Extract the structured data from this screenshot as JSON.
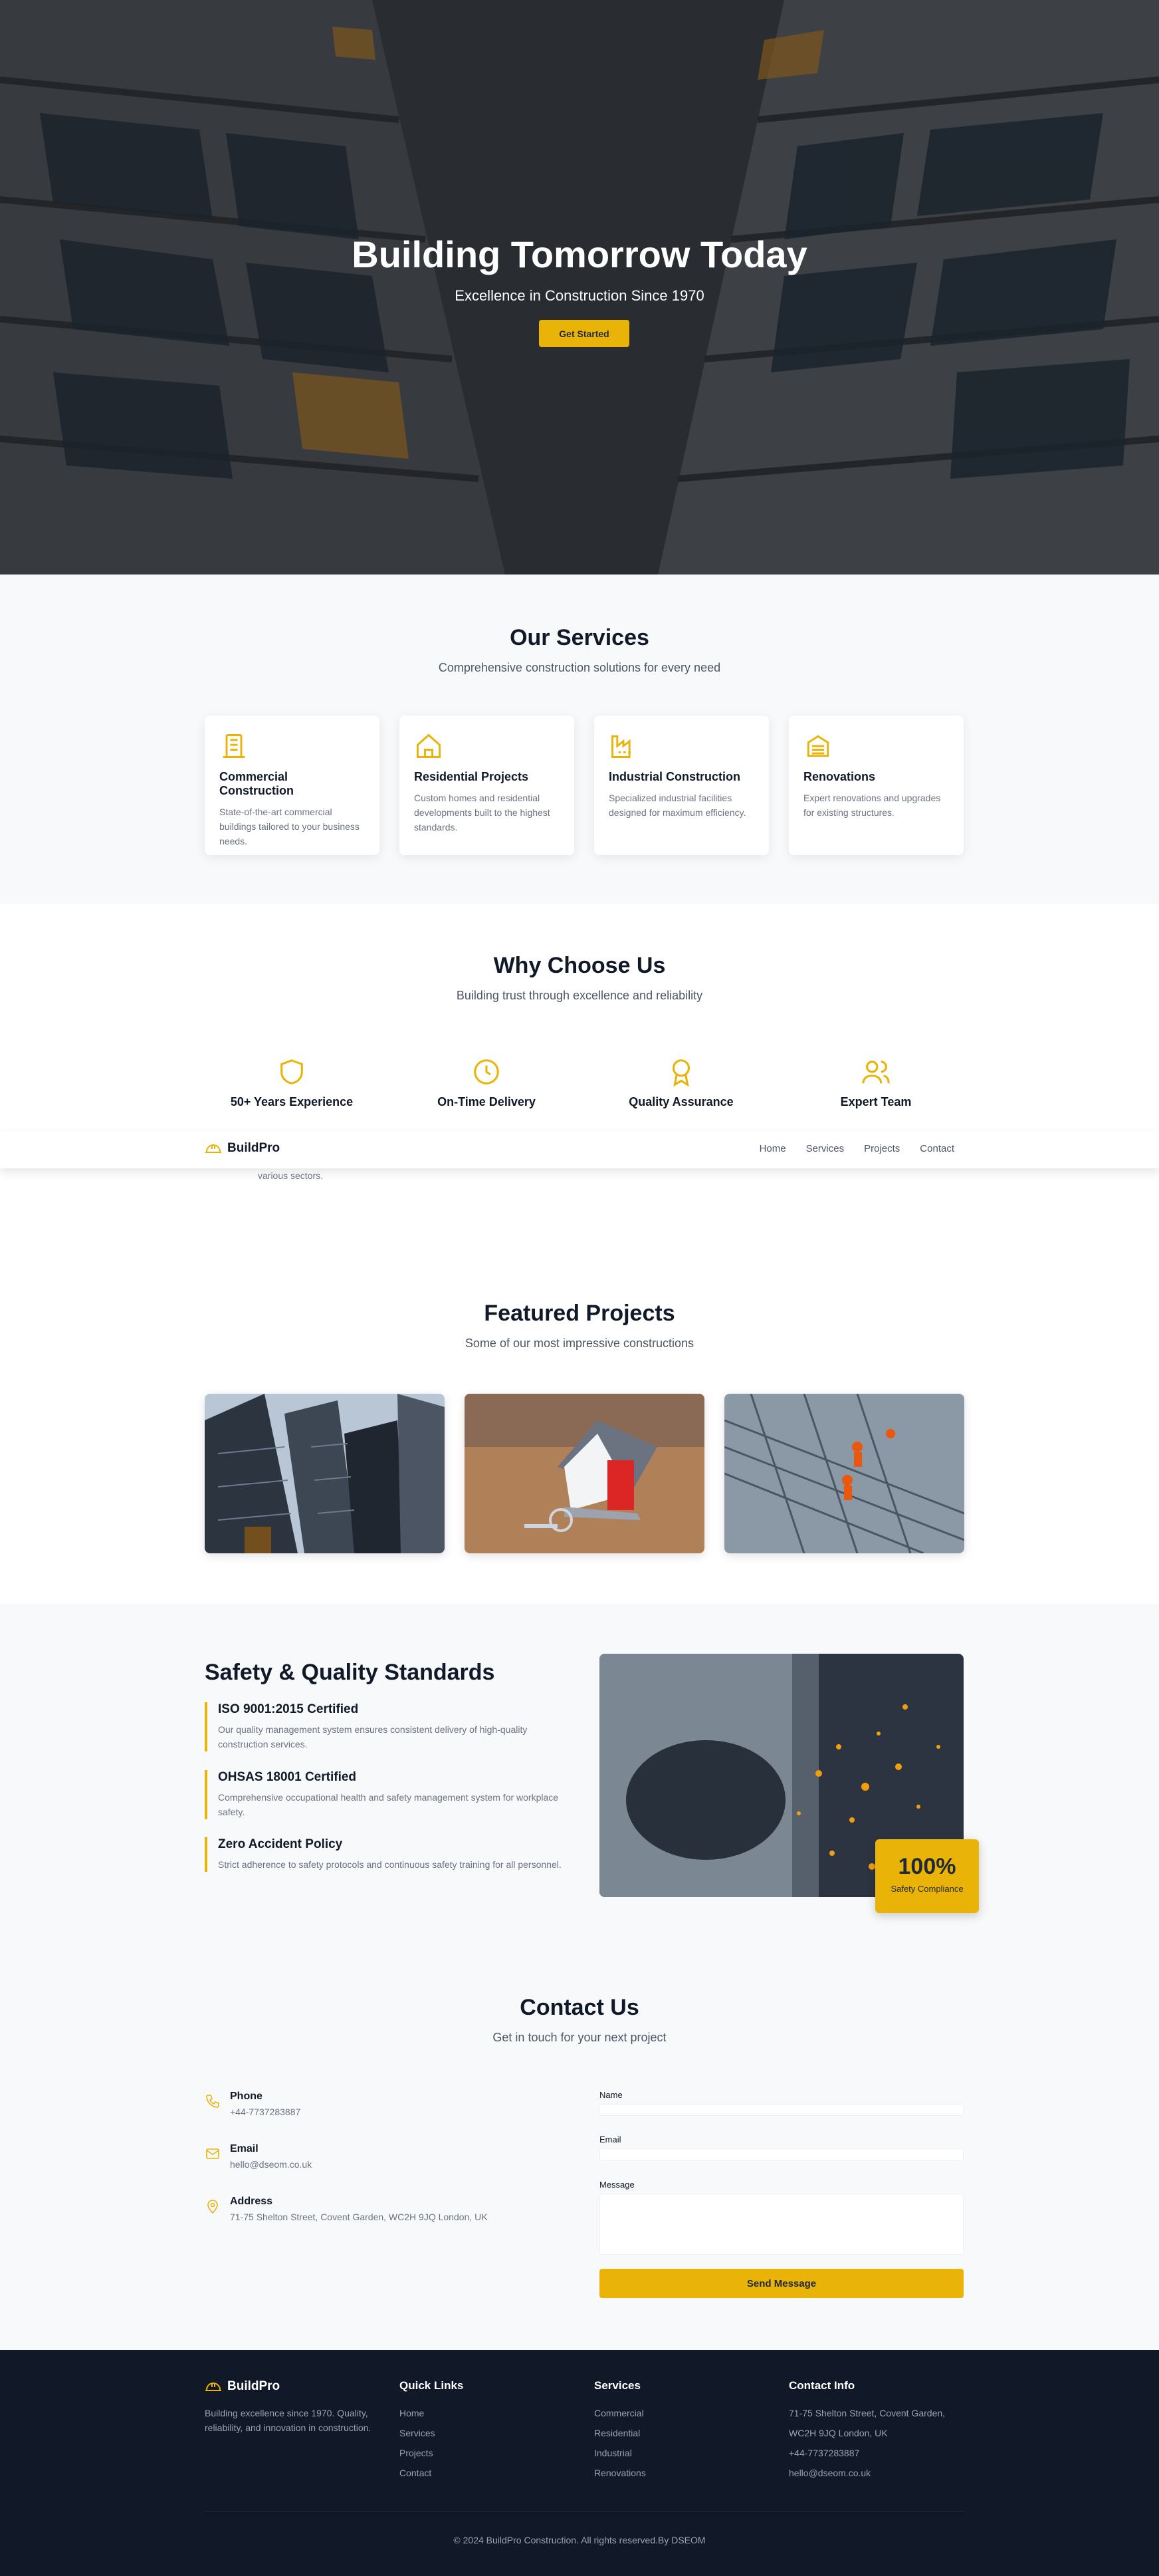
{
  "hero": {
    "title": "Building Tomorrow Today",
    "subtitle": "Excellence in Construction Since 1970",
    "cta": "Get Started"
  },
  "services": {
    "title": "Our Services",
    "subtitle": "Comprehensive construction solutions for every need",
    "items": [
      {
        "title": "Commercial Construction",
        "desc": "State-of-the-art commercial buildings tailored to your business needs.",
        "icon": "building-icon"
      },
      {
        "title": "Residential Projects",
        "desc": "Custom homes and residential developments built to the highest standards.",
        "icon": "home-icon"
      },
      {
        "title": "Industrial Construction",
        "desc": "Specialized industrial facilities designed for maximum efficiency.",
        "icon": "factory-icon"
      },
      {
        "title": "Renovations",
        "desc": "Expert renovations and upgrades for existing structures.",
        "icon": "renovation-icon"
      }
    ]
  },
  "why": {
    "title": "Why Choose Us",
    "subtitle": "Building trust through excellence and reliability",
    "items": [
      {
        "title": "50+ Years Experience",
        "icon": "shield-icon"
      },
      {
        "title": "On-Time Delivery",
        "icon": "clock-icon"
      },
      {
        "title": "Quality Assurance",
        "icon": "award-icon"
      },
      {
        "title": "Expert Team",
        "icon": "users-icon"
      }
    ],
    "peek_text": "various sectors."
  },
  "nav": {
    "brand": "BuildPro",
    "links": [
      "Home",
      "Services",
      "Projects",
      "Contact"
    ]
  },
  "projects": {
    "title": "Featured Projects",
    "subtitle": "Some of our most impressive constructions"
  },
  "safety": {
    "title": "Safety & Quality Standards",
    "items": [
      {
        "title": "ISO 9001:2015 Certified",
        "desc": "Our quality management system ensures consistent delivery of high-quality construction services."
      },
      {
        "title": "OHSAS 18001 Certified",
        "desc": "Comprehensive occupational health and safety management system for workplace safety."
      },
      {
        "title": "Zero Accident Policy",
        "desc": "Strict adherence to safety protocols and continuous safety training for all personnel."
      }
    ],
    "badge_value": "100%",
    "badge_label": "Safety Compliance"
  },
  "contact": {
    "title": "Contact Us",
    "subtitle": "Get in touch for your next project",
    "info": [
      {
        "label": "Phone",
        "value": "+44-7737283887",
        "icon": "phone-icon"
      },
      {
        "label": "Email",
        "value": "hello@dseom.co.uk",
        "icon": "mail-icon"
      },
      {
        "label": "Address",
        "value": "71-75 Shelton Street, Covent Garden, WC2H 9JQ London, UK",
        "icon": "map-pin-icon"
      }
    ],
    "form": {
      "name_label": "Name",
      "email_label": "Email",
      "message_label": "Message",
      "submit": "Send Message"
    }
  },
  "footer": {
    "brand": "BuildPro",
    "desc": "Building excellence since 1970. Quality, reliability, and innovation in construction.",
    "quick_title": "Quick Links",
    "quick_links": [
      "Home",
      "Services",
      "Projects",
      "Contact"
    ],
    "services_title": "Services",
    "services": [
      "Commercial",
      "Residential",
      "Industrial",
      "Renovations"
    ],
    "info_title": "Contact Info",
    "info": [
      "71-75 Shelton Street, Covent Garden,",
      "WC2H 9JQ London, UK",
      "+44-7737283887",
      "hello@dseom.co.uk"
    ],
    "copyright": "© 2024 BuildPro Construction. All rights reserved.By DSEOM"
  },
  "colors": {
    "accent": "#eab308",
    "dark": "#111827",
    "section_bg": "#f8f9fb"
  }
}
